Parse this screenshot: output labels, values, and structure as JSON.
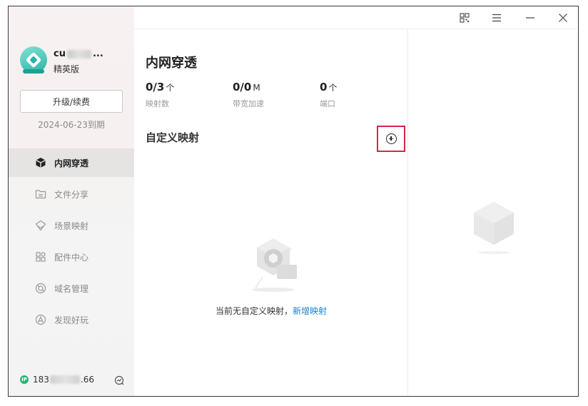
{
  "user": {
    "name_prefix": "cu",
    "name_suffix": "...",
    "plan": "精英版",
    "upgrade_label": "升级/续费",
    "expire": "2024-06-23到期"
  },
  "nav": {
    "items": [
      {
        "label": "内网穿透",
        "icon": "cube-icon",
        "active": true
      },
      {
        "label": "文件分享",
        "icon": "folder-share-icon",
        "active": false
      },
      {
        "label": "场景映射",
        "icon": "scene-icon",
        "active": false
      },
      {
        "label": "配件中心",
        "icon": "grid-icon",
        "active": false
      },
      {
        "label": "域名管理",
        "icon": "domain-icon",
        "active": false
      },
      {
        "label": "发现好玩",
        "icon": "compass-icon",
        "active": false
      }
    ]
  },
  "footer": {
    "ip_badge": "IP",
    "ip_prefix": "183",
    "ip_suffix": ".66"
  },
  "main": {
    "title": "内网穿透",
    "stats": [
      {
        "value": "0/3",
        "unit": "个",
        "label": "映射数"
      },
      {
        "value": "0/0",
        "unit": "M",
        "label": "带宽加速"
      },
      {
        "value": "0",
        "unit": "个",
        "label": "端口"
      }
    ],
    "section_title": "自定义映射",
    "empty_text": "当前无自定义映射，",
    "empty_link": "新增映射"
  },
  "colors": {
    "accent": "#1a7fd4",
    "highlight_border": "#d9254a",
    "brand_teal": "#2bb3a5",
    "ip_green": "#2bb37a"
  }
}
